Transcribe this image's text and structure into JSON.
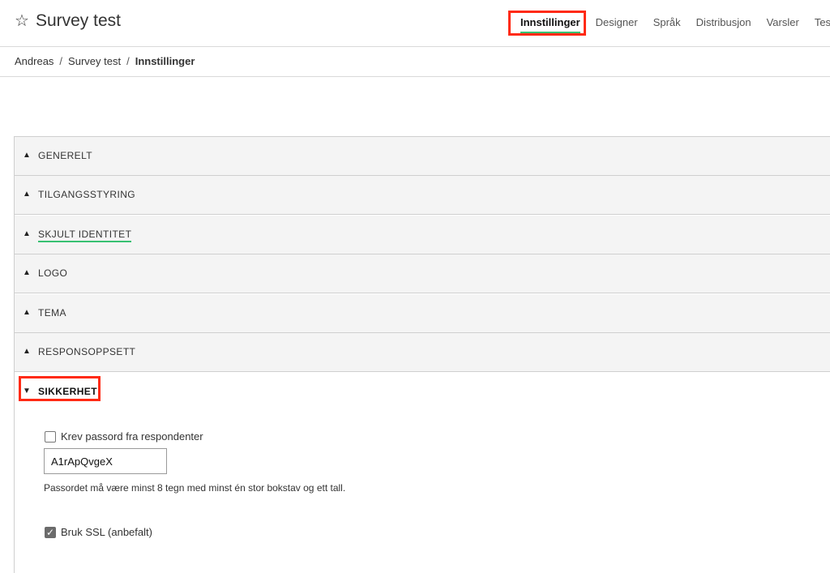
{
  "header": {
    "title": "Survey test",
    "star_icon": "☆",
    "nav": [
      {
        "label": "Innstillinger",
        "active": true
      },
      {
        "label": "Designer"
      },
      {
        "label": "Språk"
      },
      {
        "label": "Distribusjon"
      },
      {
        "label": "Varsler"
      },
      {
        "label": "Test"
      }
    ]
  },
  "breadcrumb": {
    "items": [
      "Andreas",
      "Survey test",
      "Innstillinger"
    ],
    "separator": "/"
  },
  "sections": [
    {
      "label": "GENERELT",
      "arrow": "▲"
    },
    {
      "label": "TILGANGSSTYRING",
      "arrow": "▲"
    },
    {
      "label": "SKJULT IDENTITET",
      "arrow": "▲"
    },
    {
      "label": "LOGO",
      "arrow": "▲"
    },
    {
      "label": "TEMA",
      "arrow": "▲"
    },
    {
      "label": "RESPONSOPPSETT",
      "arrow": "▲"
    },
    {
      "label": "SIKKERHET",
      "arrow": "▼"
    }
  ],
  "security": {
    "require_password_label": "Krev passord fra respondenter",
    "require_password_checked": false,
    "password_value": "A1rApQvgeX",
    "password_hint": "Passordet må være minst 8 tegn med minst én stor bokstav og ett tall.",
    "ssl_label": "Bruk SSL (anbefalt)",
    "ssl_checked": true,
    "check_glyph": "✓"
  },
  "colors": {
    "accent_underline": "#38c172",
    "highlight_box": "#ff2a14"
  }
}
